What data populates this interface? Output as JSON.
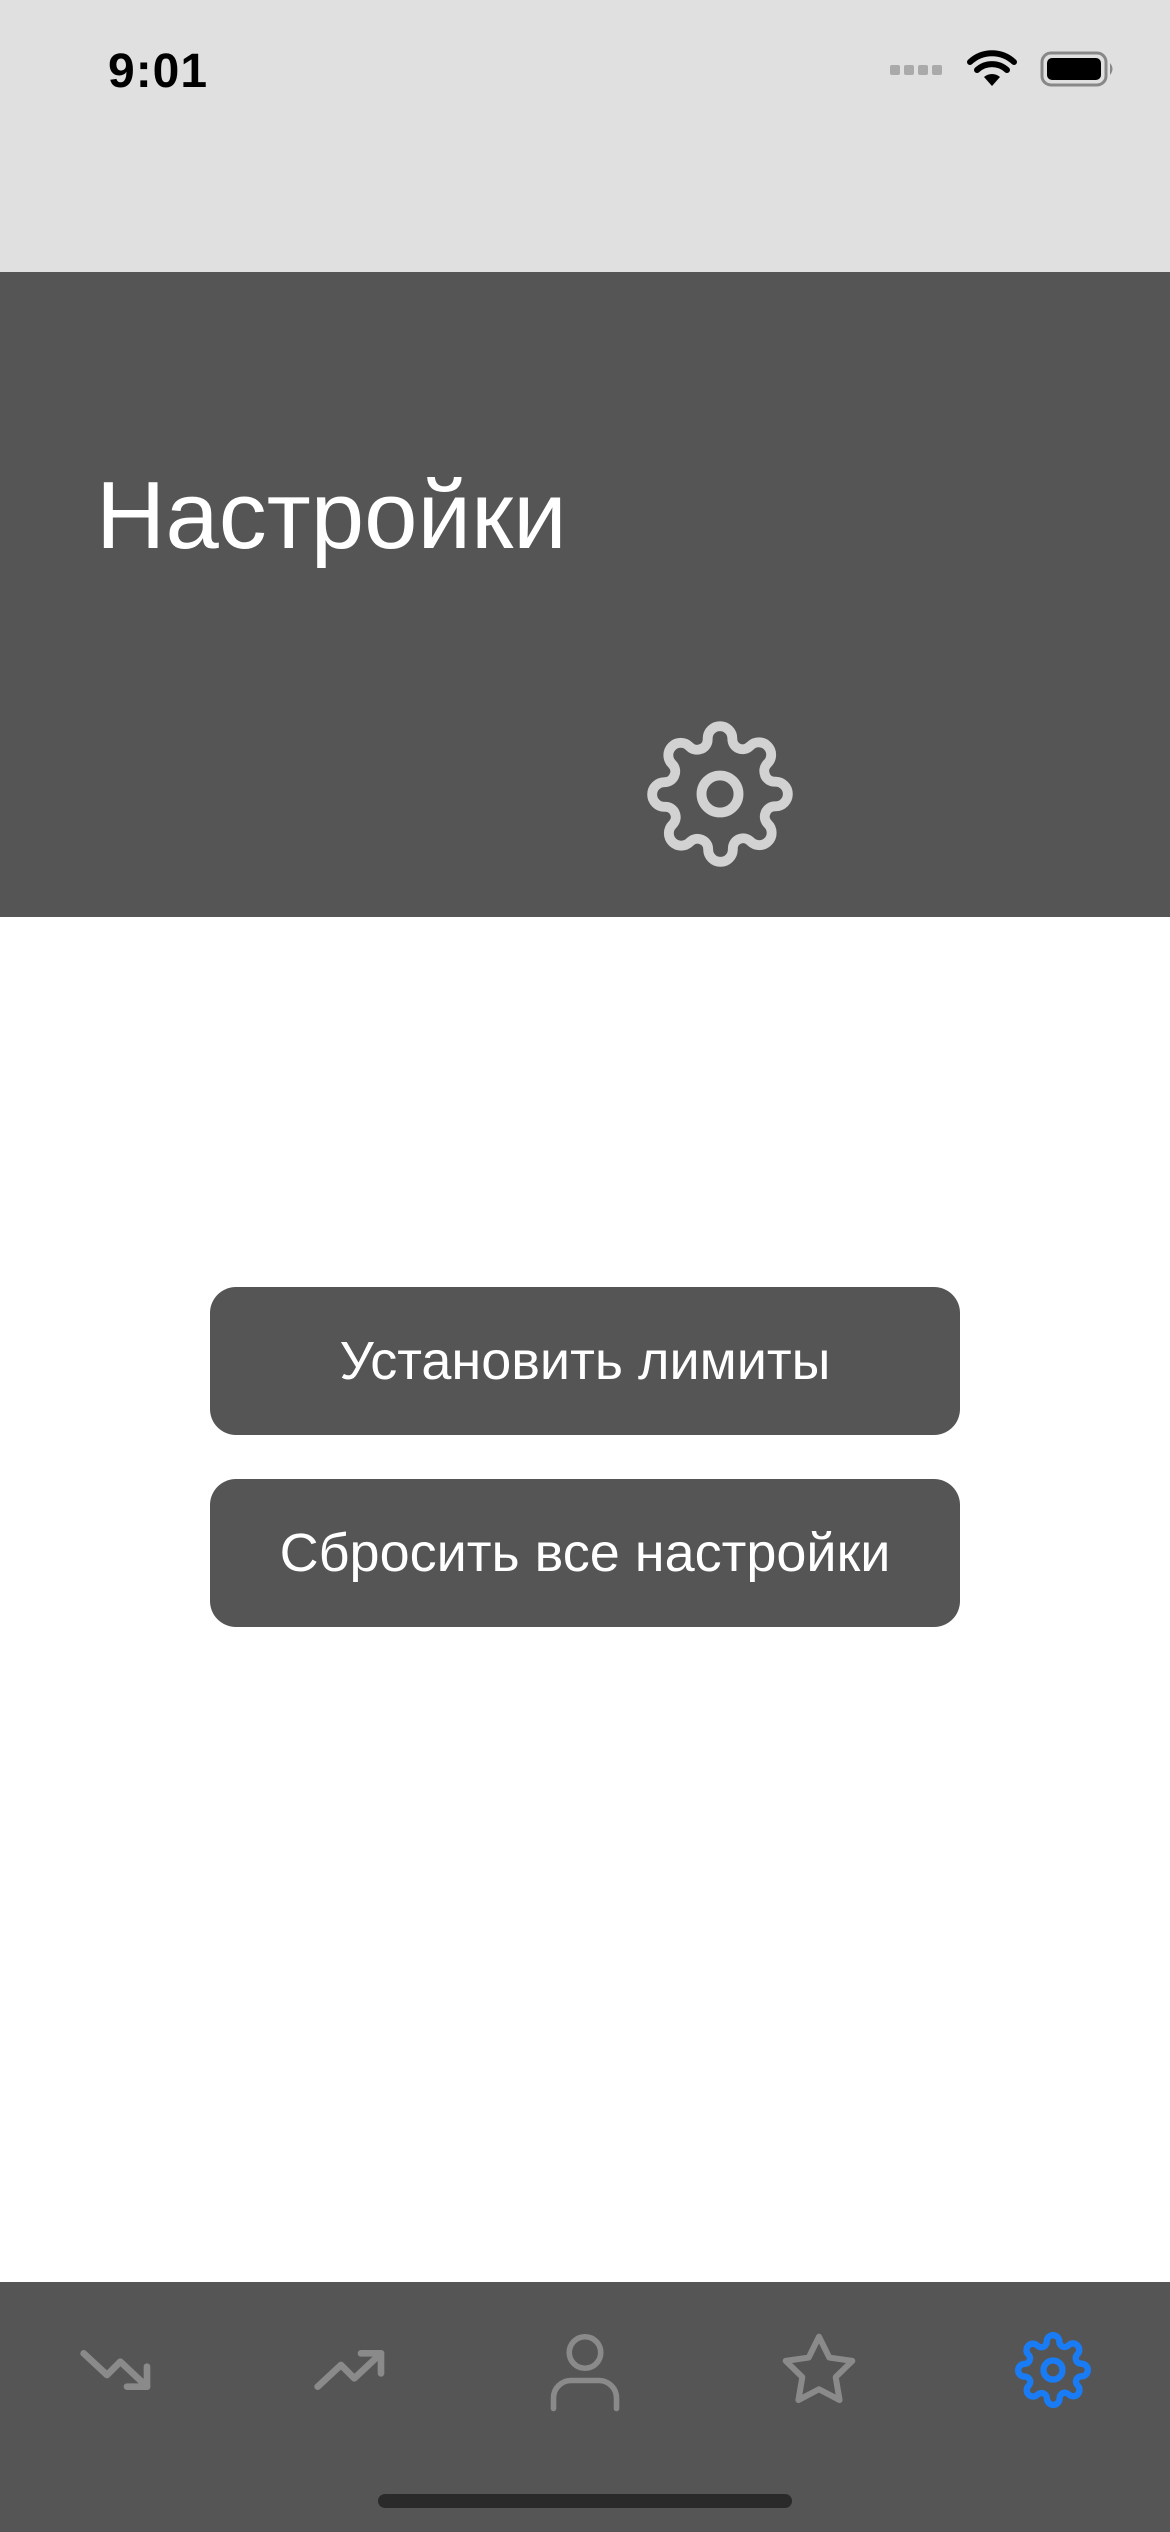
{
  "status_bar": {
    "time": "9:01",
    "icons": [
      "cellular-signal-icon",
      "wifi-icon",
      "battery-icon"
    ]
  },
  "header": {
    "title": "Настройки",
    "icon": "gear-icon"
  },
  "actions": {
    "set_limits_label": "Установить лимиты",
    "reset_all_label": "Сбросить все настройки"
  },
  "tab_bar": {
    "tabs": [
      {
        "icon": "trending-down-icon",
        "selected": false
      },
      {
        "icon": "trending-up-icon",
        "selected": false
      },
      {
        "icon": "person-icon",
        "selected": false
      },
      {
        "icon": "star-icon",
        "selected": false
      },
      {
        "icon": "gear-icon",
        "selected": true
      }
    ]
  },
  "colors": {
    "status_bar_bg": "#e0e0e0",
    "header_bg": "#555555",
    "button_bg": "#555555",
    "tab_bar_bg": "#555555",
    "tab_inactive": "#8a8a8a",
    "tab_active": "#1a7cf5",
    "header_icon": "#d2d2d2"
  }
}
